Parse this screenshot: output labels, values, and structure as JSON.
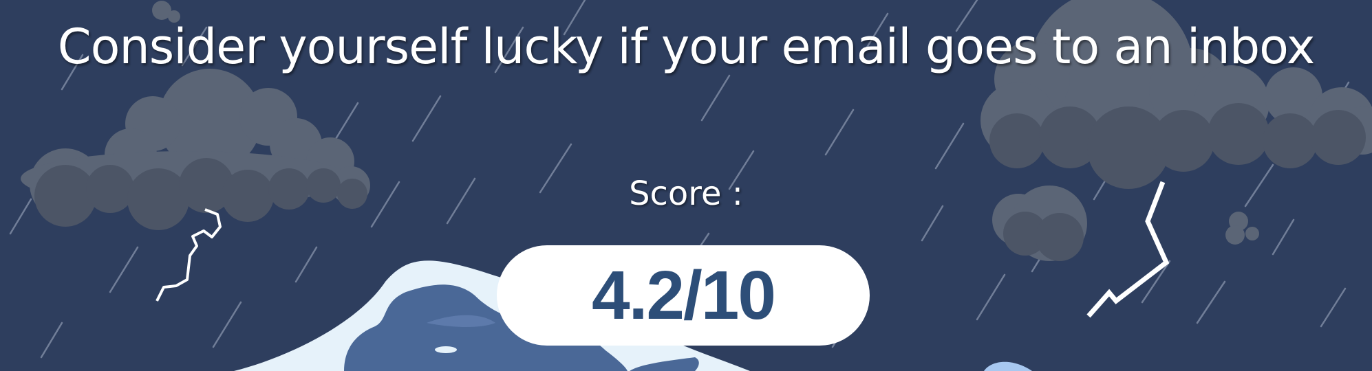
{
  "page": {
    "headline": "Consider yourself lucky if your email goes to an inbox",
    "score_label": "Score :",
    "score_value": "4.2/10"
  },
  "theme": {
    "background": "#2e3e5e",
    "cloud": "#5b6576",
    "cloud_shade": "#4c5566",
    "rain": "#a9b4c8",
    "lightning": "#ffffff",
    "wave_light": "#e6f2fa",
    "wave_dark": "#4a6897",
    "score_text": "#2d4e78"
  },
  "icons": [
    "storm-cloud-icon",
    "lightning-bolt-icon",
    "rain-icon",
    "wave-icon"
  ]
}
